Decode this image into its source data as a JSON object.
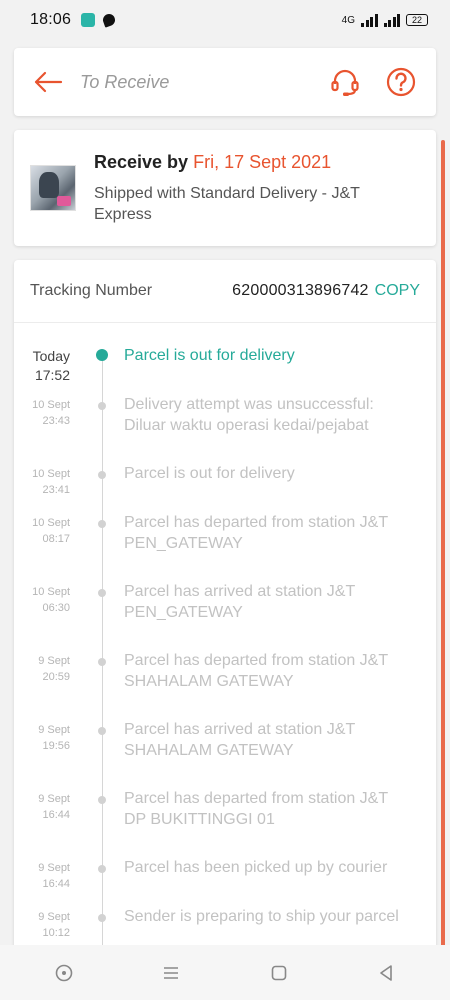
{
  "status_bar": {
    "time": "18:06",
    "network": "4G",
    "battery": "22"
  },
  "header": {
    "title": "To Receive",
    "back_icon": "arrow-left-icon",
    "support_icon": "headset-icon",
    "help_icon": "question-circle-icon",
    "accent_color": "#e8542f"
  },
  "delivery": {
    "receive_prefix": "Receive by",
    "receive_date": "Fri, 17 Sept 2021",
    "shipping_text": "Shipped with Standard Delivery  - J&T Express"
  },
  "tracking": {
    "label": "Tracking Number",
    "number": "620000313896742",
    "copy_label": "COPY",
    "copy_color": "#26aa99",
    "events": [
      {
        "date": "Today",
        "time": "17:52",
        "text": "Parcel is out for delivery",
        "current": true
      },
      {
        "date": "10 Sept",
        "time": "23:43",
        "text": "Delivery attempt was unsuccessful: Diluar waktu operasi kedai/pejabat"
      },
      {
        "date": "10 Sept",
        "time": "23:41",
        "text": "Parcel is out for delivery"
      },
      {
        "date": "10 Sept",
        "time": "08:17",
        "text": "Parcel has departed from station J&T PEN_GATEWAY"
      },
      {
        "date": "10 Sept",
        "time": "06:30",
        "text": "Parcel has arrived at station J&T PEN_GATEWAY"
      },
      {
        "date": "9 Sept",
        "time": "20:59",
        "text": "Parcel has departed from station J&T SHAHALAM GATEWAY"
      },
      {
        "date": "9 Sept",
        "time": "19:56",
        "text": "Parcel has arrived at station J&T SHAHALAM GATEWAY"
      },
      {
        "date": "9 Sept",
        "time": "16:44",
        "text": "Parcel has departed from station J&T DP BUKITTINGGI 01"
      },
      {
        "date": "9 Sept",
        "time": "16:44",
        "text": "Parcel has been picked up by courier"
      },
      {
        "date": "9 Sept",
        "time": "10:12",
        "text": "Sender is preparing to ship your parcel"
      }
    ]
  },
  "nav_bar": {
    "icons": [
      "assistant-icon",
      "menu-icon",
      "home-square-icon",
      "back-triangle-icon"
    ]
  }
}
